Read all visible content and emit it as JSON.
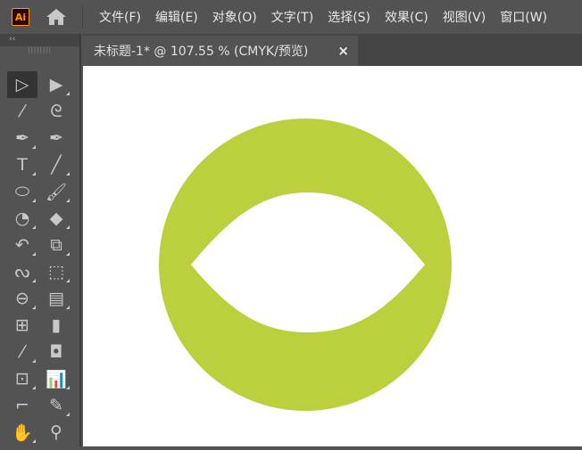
{
  "app": {
    "logo": "Ai"
  },
  "menu": [
    "文件(F)",
    "编辑(E)",
    "对象(O)",
    "文字(T)",
    "选择(S)",
    "效果(C)",
    "视图(V)",
    "窗口(W)"
  ],
  "panel": {
    "collapse": "‹‹",
    "grip": "||||||||"
  },
  "tools": [
    {
      "icon": "selection-tool-icon",
      "glyph": "▷",
      "selected": true,
      "sub": false
    },
    {
      "icon": "direct-selection-tool-icon",
      "glyph": "▶",
      "sub": true
    },
    {
      "icon": "magic-wand-tool-icon",
      "glyph": "⁄",
      "sub": false
    },
    {
      "icon": "lasso-tool-icon",
      "glyph": "ᘓ",
      "sub": false
    },
    {
      "icon": "pen-tool-icon",
      "glyph": "✒",
      "sub": true
    },
    {
      "icon": "curvature-tool-icon",
      "glyph": "✒",
      "sub": false
    },
    {
      "icon": "type-tool-icon",
      "glyph": "T",
      "sub": true
    },
    {
      "icon": "line-tool-icon",
      "glyph": "╱",
      "sub": true
    },
    {
      "icon": "ellipse-tool-icon",
      "glyph": "⬭",
      "sub": true
    },
    {
      "icon": "paintbrush-tool-icon",
      "glyph": "🖌",
      "sub": true
    },
    {
      "icon": "shaper-tool-icon",
      "glyph": "◔",
      "sub": true
    },
    {
      "icon": "eraser-tool-icon",
      "glyph": "◆",
      "sub": true
    },
    {
      "icon": "rotate-tool-icon",
      "glyph": "↶",
      "sub": true
    },
    {
      "icon": "scale-tool-icon",
      "glyph": "⧉",
      "sub": true
    },
    {
      "icon": "puppet-warp-tool-icon",
      "glyph": "ᔓ",
      "sub": true
    },
    {
      "icon": "free-transform-tool-icon",
      "glyph": "⬚",
      "sub": true
    },
    {
      "icon": "shape-builder-tool-icon",
      "glyph": "⊖",
      "sub": true
    },
    {
      "icon": "perspective-grid-tool-icon",
      "glyph": "▤",
      "sub": true
    },
    {
      "icon": "mesh-tool-icon",
      "glyph": "⊞",
      "sub": false
    },
    {
      "icon": "gradient-tool-icon",
      "glyph": "▮",
      "sub": false
    },
    {
      "icon": "eyedropper-tool-icon",
      "glyph": "⁄",
      "sub": true
    },
    {
      "icon": "blend-tool-icon",
      "glyph": "◘",
      "sub": false
    },
    {
      "icon": "symbol-sprayer-tool-icon",
      "glyph": "⊡",
      "sub": true
    },
    {
      "icon": "column-graph-tool-icon",
      "glyph": "📊",
      "sub": true
    },
    {
      "icon": "artboard-tool-icon",
      "glyph": "⌐",
      "sub": false
    },
    {
      "icon": "slice-tool-icon",
      "glyph": "✎",
      "sub": true
    },
    {
      "icon": "hand-tool-icon",
      "glyph": "✋",
      "sub": true
    },
    {
      "icon": "zoom-tool-icon",
      "glyph": "⚲",
      "sub": false
    }
  ],
  "document_tab": {
    "title": "未标题-1* @ 107.55 % (CMYK/预览)",
    "close": "×"
  },
  "colors": {
    "shape_fill": "#bccf3d"
  }
}
